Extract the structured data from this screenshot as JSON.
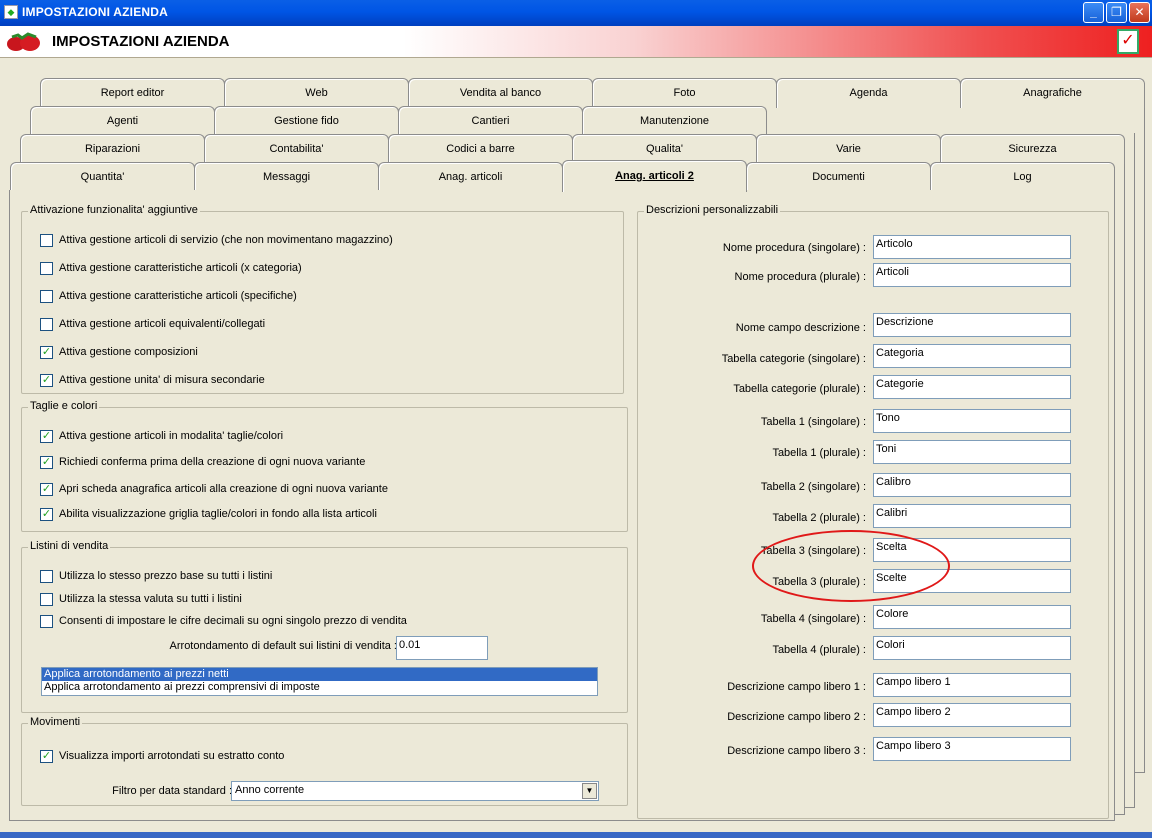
{
  "window": {
    "title": "IMPOSTAZIONI AZIENDA",
    "buttons": [
      "_",
      "❐",
      "✕"
    ]
  },
  "banner": {
    "title": "IMPOSTAZIONI AZIENDA",
    "check": "✓"
  },
  "tabs": {
    "row1": [
      "Report editor",
      "Web",
      "Vendita al banco",
      "Foto",
      "Agenda",
      "Anagrafiche"
    ],
    "row2": [
      "Agenti",
      "Gestione fido",
      "Cantieri",
      "Manutenzione"
    ],
    "row3": [
      "Riparazioni",
      "Contabilita'",
      "Codici a barre",
      "Qualita'",
      "Varie",
      "Sicurezza"
    ],
    "row4": [
      "Quantita'",
      "Messaggi",
      "Anag. articoli",
      "Anag. articoli 2",
      "Documenti",
      "Log"
    ]
  },
  "attivazione": {
    "title": "Attivazione funzionalita' aggiuntive",
    "items": [
      {
        "label": "Attiva gestione articoli di servizio (che non movimentano magazzino)",
        "mark": ""
      },
      {
        "label": "Attiva gestione caratteristiche articoli (x categoria)",
        "mark": ""
      },
      {
        "label": "Attiva gestione caratteristiche articoli (specifiche)",
        "mark": ""
      },
      {
        "label": "Attiva gestione articoli equivalenti/collegati",
        "mark": ""
      },
      {
        "label": "Attiva gestione composizioni",
        "mark": "✓"
      },
      {
        "label": "Attiva gestione unita' di misura secondarie",
        "mark": "✓"
      }
    ]
  },
  "taglie": {
    "title": "Taglie e colori",
    "items": [
      {
        "label": "Attiva gestione articoli in modalita' taglie/colori",
        "mark": "✓"
      },
      {
        "label": "Richiedi conferma prima della creazione di ogni nuova variante",
        "mark": "✓"
      },
      {
        "label": "Apri scheda anagrafica articoli alla creazione di ogni nuova variante",
        "mark": "✓"
      },
      {
        "label": "Abilita visualizzazione griglia taglie/colori in fondo alla lista articoli",
        "mark": "✓"
      }
    ]
  },
  "listini": {
    "title": "Listini di vendita",
    "items": [
      {
        "label": "Utilizza lo stesso prezzo base su tutti i listini",
        "mark": ""
      },
      {
        "label": "Utilizza la stessa valuta su tutti i listini",
        "mark": ""
      },
      {
        "label": "Consenti di impostare le cifre decimali su ogni singolo prezzo di vendita",
        "mark": ""
      }
    ],
    "arrot_label": "Arrotondamento di default sui listini di vendita :",
    "arrot_value": "0.01",
    "options": [
      "Applica arrotondamento ai prezzi netti",
      "Applica arrotondamento ai prezzi comprensivi di imposte"
    ]
  },
  "movimenti": {
    "title": "Movimenti",
    "item": {
      "label": "Visualizza importi arrotondati su estratto conto",
      "mark": "✓"
    },
    "filtro_label": "Filtro per data standard :",
    "filtro_value": "Anno corrente",
    "arrow": "▼"
  },
  "descrizioni": {
    "title": "Descrizioni personalizzabili",
    "fields": [
      {
        "label": "Nome procedura (singolare) :",
        "value": "Articolo"
      },
      {
        "label": "Nome procedura (plurale) :",
        "value": "Articoli"
      },
      {
        "label": "Nome campo descrizione :",
        "value": "Descrizione"
      },
      {
        "label": "Tabella categorie (singolare) :",
        "value": "Categoria"
      },
      {
        "label": "Tabella categorie (plurale) :",
        "value": "Categorie"
      },
      {
        "label": "Tabella 1 (singolare) :",
        "value": "Tono"
      },
      {
        "label": "Tabella 1 (plurale) :",
        "value": "Toni"
      },
      {
        "label": "Tabella 2 (singolare) :",
        "value": "Calibro"
      },
      {
        "label": "Tabella 2 (plurale) :",
        "value": "Calibri"
      },
      {
        "label": "Tabella 3 (singolare) :",
        "value": "Scelta"
      },
      {
        "label": "Tabella 3 (plurale) :",
        "value": "Scelte"
      },
      {
        "label": "Tabella 4 (singolare) :",
        "value": "Colore"
      },
      {
        "label": "Tabella 4 (plurale) :",
        "value": "Colori"
      },
      {
        "label": "Descrizione campo libero 1 :",
        "value": "Campo libero 1"
      },
      {
        "label": "Descrizione campo libero 2 :",
        "value": "Campo libero 2"
      },
      {
        "label": "Descrizione campo libero 3 :",
        "value": "Campo libero 3"
      }
    ]
  }
}
